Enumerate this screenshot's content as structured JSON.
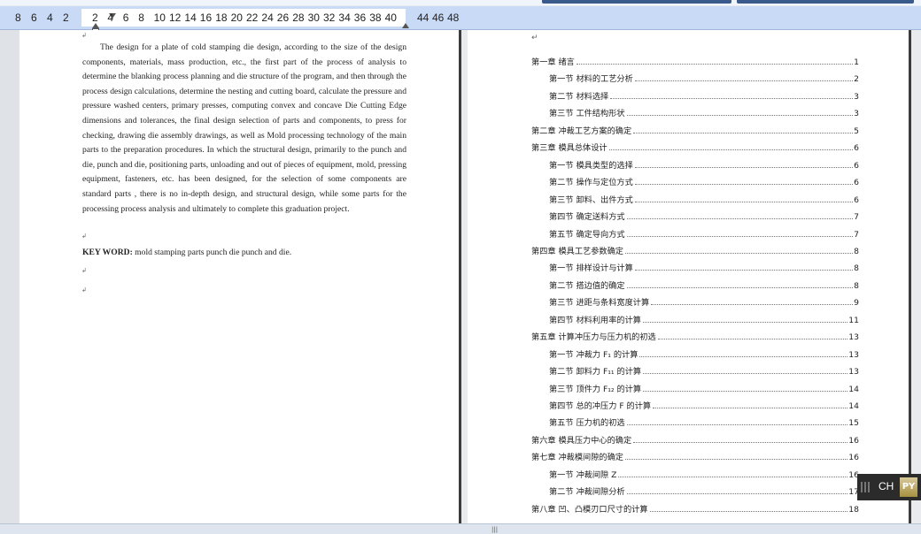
{
  "ruler": {
    "left_numbers": [
      "8",
      "6",
      "4",
      "2"
    ],
    "numbers": [
      "2",
      "4",
      "6",
      "8",
      "10",
      "12",
      "14",
      "16",
      "18",
      "20",
      "22",
      "24",
      "26",
      "28",
      "30",
      "32",
      "34",
      "36",
      "38",
      "40"
    ],
    "right_numbers": [
      "44",
      "46",
      "48"
    ]
  },
  "left_page": {
    "top_mark": "↲",
    "abstract": "The design for a plate of cold stamping die design, according to the size of the design components, materials, mass production, etc., the first part of the process of analysis to determine the blanking process planning and die structure of the program, and then through the process design calculations, determine the nesting and cutting board, calculate the pressure and pressure washed centers, primary presses, computing convex and concave Die Cutting Edge dimensions and tolerances, the final design selection of parts and components, to press for checking, drawing die assembly drawings, as well as Mold processing technology of the main parts to the preparation procedures. In which the structural design, primarily to the punch and die, punch and die, positioning parts, unloading and out of pieces of equipment, mold, pressing equipment, fasteners, etc. has been designed, for the selection of some components are standard parts , there is no in-depth design, and structural design, while some parts for the processing process analysis and ultimately to complete this graduation project.",
    "para_end_mark": "↲",
    "keyword_label": "KEY WORD:",
    "keyword_text": " mold    stamping parts    punch     die     punch and die.",
    "extra_marks": [
      "↲",
      "↲"
    ]
  },
  "right_page": {
    "top_mark": "↵",
    "toc": [
      {
        "label": "第一章  绪言",
        "page": "1",
        "level": 1
      },
      {
        "label": "第一节  材料的工艺分析",
        "page": "2",
        "level": 2
      },
      {
        "label": "第二节  材料选择",
        "page": "3",
        "level": 2
      },
      {
        "label": "第三节  工件结构形状",
        "page": "3",
        "level": 2
      },
      {
        "label": "第二章  冲裁工艺方案的确定",
        "page": "5",
        "level": 1
      },
      {
        "label": "第三章  模具总体设计",
        "page": "6",
        "level": 1
      },
      {
        "label": "第一节  模具类型的选择",
        "page": "6",
        "level": 2
      },
      {
        "label": "第二节  操作与定位方式",
        "page": "6",
        "level": 2
      },
      {
        "label": "第三节  卸料、出件方式",
        "page": "6",
        "level": 2
      },
      {
        "label": "第四节  确定送料方式",
        "page": "7",
        "level": 2
      },
      {
        "label": "第五节  确定导向方式",
        "page": "7",
        "level": 2
      },
      {
        "label": "第四章  模具工艺参数确定",
        "page": "8",
        "level": 1
      },
      {
        "label": "第一节  排样设计与计算",
        "page": "8",
        "level": 2
      },
      {
        "label": "第二节  搭边值的确定",
        "page": "8",
        "level": 2
      },
      {
        "label": "第三节  进距与条料宽度计算",
        "page": "9",
        "level": 2
      },
      {
        "label": "第四节  材料利用率的计算",
        "page": "11",
        "level": 2
      },
      {
        "label": "第五章  计算冲压力与压力机的初选",
        "page": "13",
        "level": 1
      },
      {
        "label": "第一节  冲裁力 F₁ 的计算",
        "page": "13",
        "level": 2
      },
      {
        "label": "第二节  卸料力 F₁₁ 的计算",
        "page": "13",
        "level": 2
      },
      {
        "label": "第三节  顶件力 F₁₂ 的计算",
        "page": "14",
        "level": 2
      },
      {
        "label": "第四节  总的冲压力 F 的计算",
        "page": "14",
        "level": 2
      },
      {
        "label": "第五节  压力机的初选",
        "page": "15",
        "level": 2
      },
      {
        "label": "第六章  模具压力中心的确定",
        "page": "16",
        "level": 1
      },
      {
        "label": "第七章  冲裁模间隙的确定",
        "page": "16",
        "level": 1
      },
      {
        "label": "第一节  冲裁间隙 Z",
        "page": "16",
        "level": 2
      },
      {
        "label": "第二节  冲裁间隙分析",
        "page": "17",
        "level": 2
      },
      {
        "label": "第八章  凹、凸模刃口尺寸的计算",
        "page": "18",
        "level": 1
      }
    ]
  },
  "ime": {
    "lang": "CH",
    "logo": "PY"
  },
  "statusbar": {
    "grip": "|||"
  }
}
